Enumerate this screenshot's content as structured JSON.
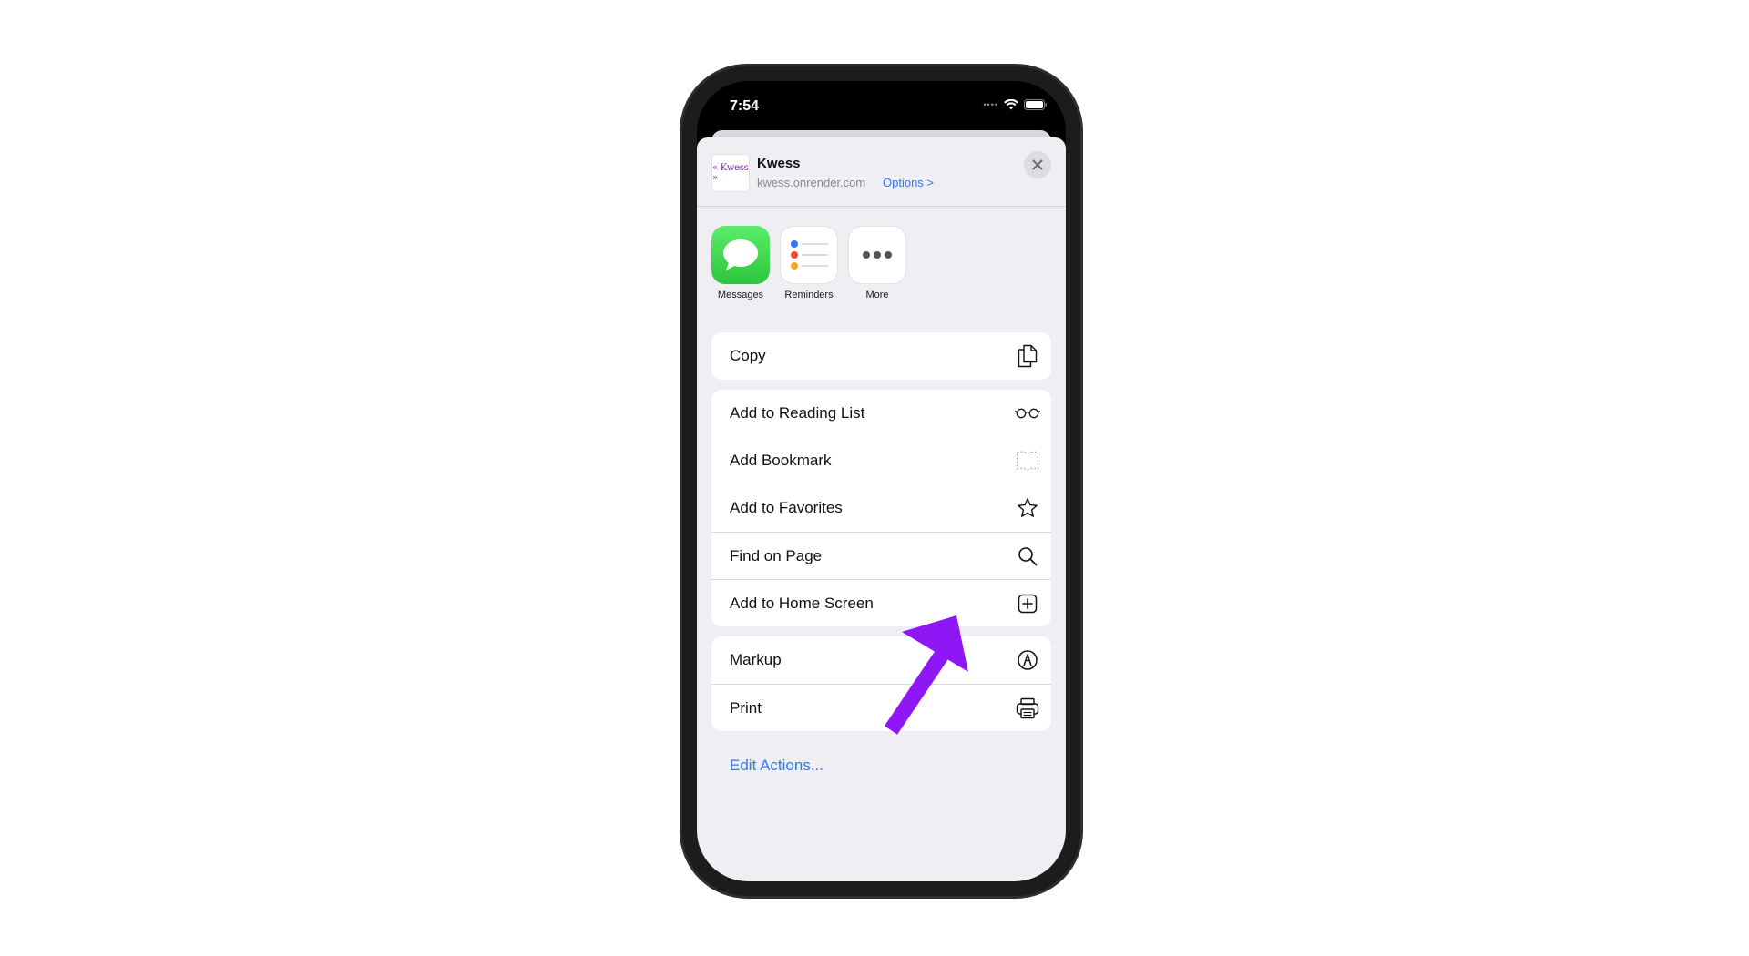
{
  "status": {
    "time": "7:54"
  },
  "share_header": {
    "site_logo_text": "« Kwess »",
    "title": "Kwess",
    "url": "kwess.onrender.com",
    "options_label": "Options >"
  },
  "apps": [
    {
      "label": "Messages",
      "icon": "messages-icon"
    },
    {
      "label": "Reminders",
      "icon": "reminders-icon"
    },
    {
      "label": "More",
      "icon": "more-icon"
    }
  ],
  "actions": {
    "copy": {
      "label": "Copy",
      "icon": "copy-icon"
    },
    "reading_list": {
      "label": "Add to Reading List",
      "icon": "glasses-icon"
    },
    "bookmark": {
      "label": "Add Bookmark",
      "icon": "book-icon"
    },
    "favorites": {
      "label": "Add to Favorites",
      "icon": "star-icon"
    },
    "find": {
      "label": "Find on Page",
      "icon": "search-icon"
    },
    "home_screen": {
      "label": "Add to Home Screen",
      "icon": "plus-square-icon"
    },
    "markup": {
      "label": "Markup",
      "icon": "markup-icon"
    },
    "print": {
      "label": "Print",
      "icon": "printer-icon"
    }
  },
  "edit_actions_label": "Edit Actions...",
  "colors": {
    "accent": "#2f7bf0",
    "annotation_arrow": "#8f17f5",
    "messages_green": "#34c759"
  }
}
